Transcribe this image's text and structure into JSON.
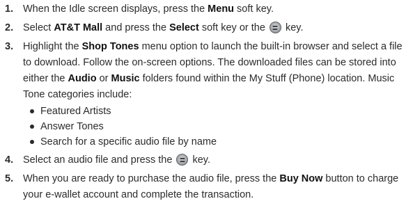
{
  "steps": [
    {
      "num": "1.",
      "parts": [
        "When the Idle screen displays, press the ",
        "Menu",
        " soft key."
      ]
    },
    {
      "num": "2.",
      "parts": [
        "Select ",
        "AT&T Mall",
        " and press the ",
        "Select",
        " soft key or the ",
        " key."
      ]
    },
    {
      "num": "3.",
      "parts": [
        "Highlight the ",
        "Shop Tones",
        " menu option to launch the built-in browser and select a file to download. Follow the on-screen options. The downloaded files can be stored into either the ",
        "Audio",
        " or ",
        "Music",
        " folders found within the My Stuff (Phone) location. Music Tone categories include:"
      ],
      "bullets": [
        "Featured Artists",
        "Answer Tones",
        "Search for a specific audio file by name"
      ]
    },
    {
      "num": "4.",
      "parts": [
        "Select an audio file and press the ",
        " key."
      ]
    },
    {
      "num": "5.",
      "parts": [
        "When you are ready to purchase the audio file, press the ",
        "Buy Now",
        " button to charge your e-wallet account and complete the transaction."
      ]
    }
  ],
  "icons": {
    "select_key": "center-select-key-icon"
  }
}
